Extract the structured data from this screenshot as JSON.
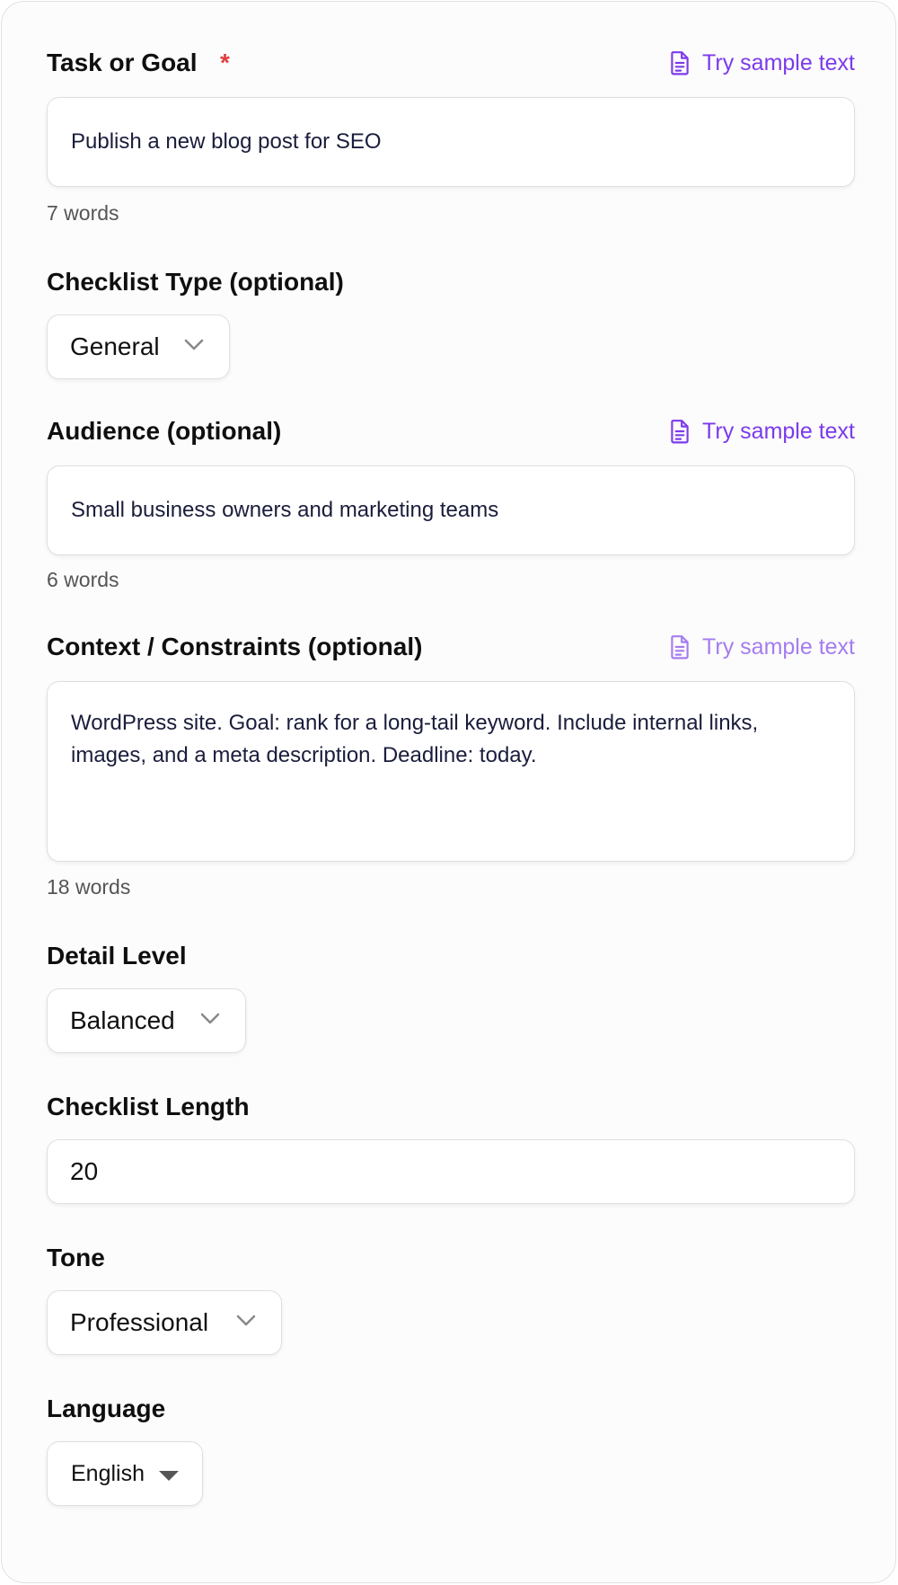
{
  "task": {
    "label": "Task or Goal",
    "required_mark": "*",
    "sample_label": "Try sample text",
    "value": "Publish a new blog post for SEO",
    "word_count": "7 words"
  },
  "checklist_type": {
    "label": "Checklist Type (optional)",
    "selected": "General"
  },
  "audience": {
    "label": "Audience (optional)",
    "sample_label": "Try sample text",
    "value": "Small business owners and marketing teams",
    "word_count": "6 words"
  },
  "context": {
    "label": "Context / Constraints (optional)",
    "sample_label": "Try sample text",
    "value": "WordPress site. Goal: rank for a long-tail keyword. Include internal links, images, and a meta description. Deadline: today.",
    "word_count": "18 words"
  },
  "detail_level": {
    "label": "Detail Level",
    "selected": "Balanced"
  },
  "checklist_length": {
    "label": "Checklist Length",
    "value": "20"
  },
  "tone": {
    "label": "Tone",
    "selected": "Professional"
  },
  "language": {
    "label": "Language",
    "selected": "English"
  },
  "colors": {
    "accent": "#7c3aed",
    "required": "#e03e3e",
    "border": "#dcdfe3"
  },
  "icons": {
    "sample": "document-icon",
    "dropdown": "chevron-down-icon",
    "language_dropdown": "caret-down-icon"
  }
}
